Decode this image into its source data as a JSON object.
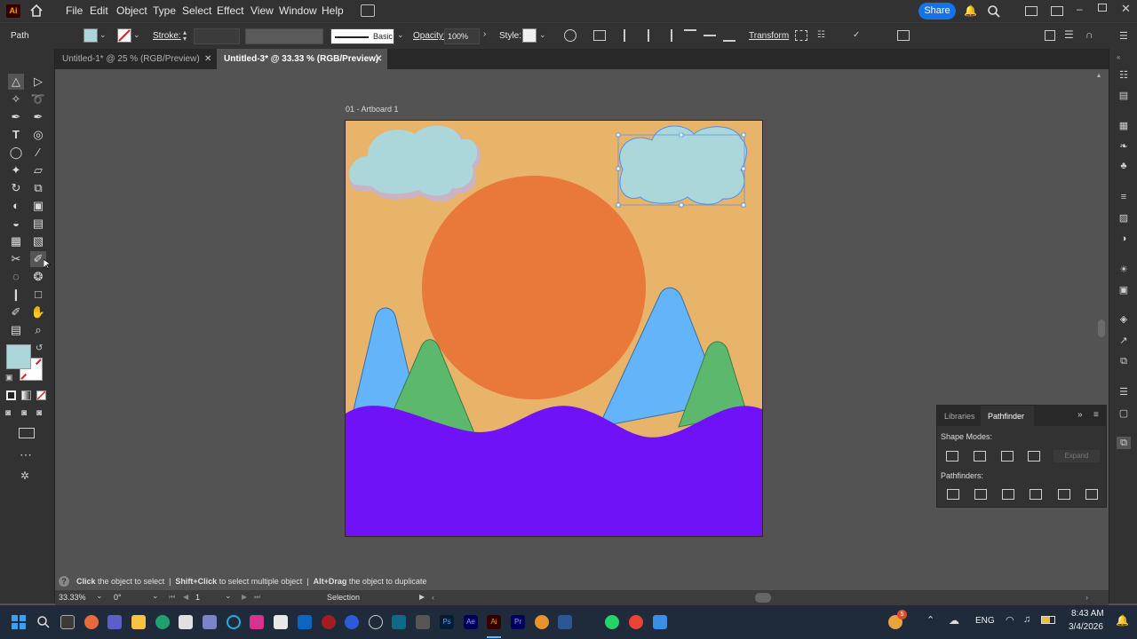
{
  "app": {
    "logo": "Ai",
    "name": "Adobe Illustrator"
  },
  "menu": [
    "File",
    "Edit",
    "Object",
    "Type",
    "Select",
    "Effect",
    "View",
    "Window",
    "Help"
  ],
  "share_label": "Share",
  "control_bar": {
    "selection_type": "Path",
    "stroke_label": "Stroke:",
    "brush_label": "Basic",
    "opacity_label": "Opacity:",
    "opacity_value": "100%",
    "style_label": "Style:",
    "transform_label": "Transform"
  },
  "tabs": [
    {
      "label": "Untitled-1* @ 25 % (RGB/Preview)",
      "active": false
    },
    {
      "label": "Untitled-3* @ 33.33 % (RGB/Preview)",
      "active": true
    }
  ],
  "artboard": {
    "label": "01 - Artboard 1"
  },
  "colors": {
    "sky": "#e8b46a",
    "sun": "#e8793a",
    "cloud": "#acd7da",
    "mountain_blue": "#64b4fa",
    "mountain_green": "#5cb86c",
    "sea": "#6f12f7",
    "selection": "#4f8ef0"
  },
  "pathfinder": {
    "tabs": [
      "Libraries",
      "Pathfinder"
    ],
    "shape_modes_label": "Shape Modes:",
    "expand_label": "Expand",
    "pathfinders_label": "Pathfinders:"
  },
  "status_hint": {
    "k1": "Click",
    "t1": "the object to select",
    "k2": "Shift+Click",
    "t2": "to select multiple object",
    "k3": "Alt+Drag",
    "t3": "the object to duplicate"
  },
  "bottom_bar": {
    "zoom": "33.33%",
    "rotation": "0°",
    "artboard_number": "1",
    "tool_name": "Selection"
  },
  "taskbar": {
    "language": "ENG",
    "time": "8:43 AM",
    "date": "3/4/2026",
    "notification_count": "5"
  }
}
